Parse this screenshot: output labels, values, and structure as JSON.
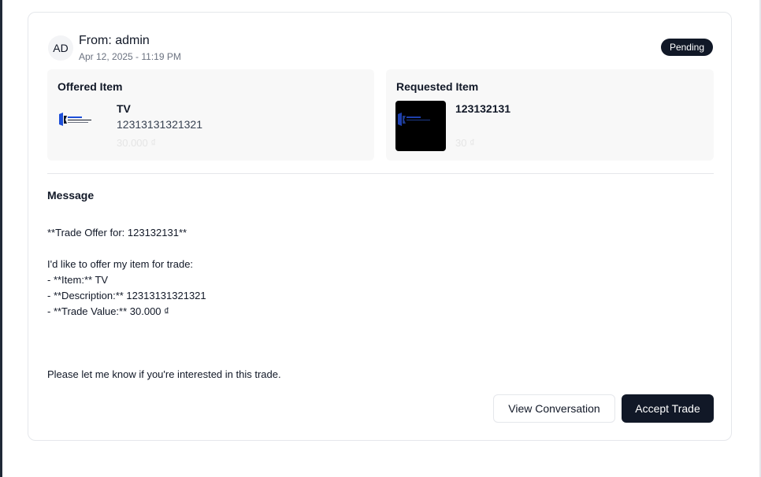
{
  "header": {
    "avatar_initials": "AD",
    "from": "From: admin",
    "date": "Apr 12, 2025 - 11:19 PM",
    "status": "Pending"
  },
  "offered": {
    "title": "Offered Item",
    "name": "TV",
    "description": "12313131321321",
    "price": "30.000 ₫"
  },
  "requested": {
    "title": "Requested Item",
    "name": "123132131",
    "price": "30 ₫"
  },
  "message": {
    "title": "Message",
    "body": "**Trade Offer for: 123132131**\n\nI'd like to offer my item for trade:\n- **Item:** TV\n- **Description:** 12313131321321\n- **Trade Value:** 30.000 ₫\n\n\n\nPlease let me know if you're interested in this trade."
  },
  "actions": {
    "view_conversation": "View Conversation",
    "accept_trade": "Accept Trade"
  },
  "colors": {
    "primary": "#111827",
    "panel_bg": "#f8f8f8",
    "muted_text": "#6b7280"
  }
}
